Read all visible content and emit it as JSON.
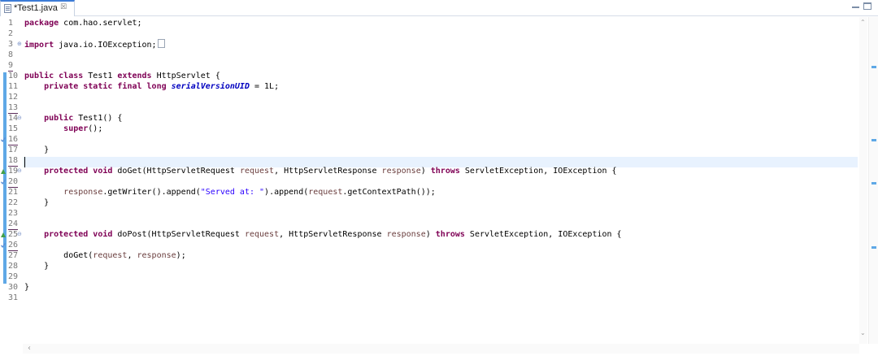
{
  "tab": {
    "title": "*Test1.java",
    "close_glyph": "☒",
    "icon": "java-file-icon"
  },
  "gutter": {
    "line_numbers": [
      "1",
      "2",
      "3",
      "8",
      "9",
      "10",
      "11",
      "12",
      "13",
      "14",
      "15",
      "16",
      "17",
      "18",
      "19",
      "20",
      "21",
      "22",
      "23",
      "24",
      "25",
      "26",
      "27",
      "28",
      "29",
      "30",
      "31"
    ]
  },
  "code": {
    "l1_kw": "package",
    "l1_rest": " com.hao.servlet;",
    "l3_kw": "import",
    "l3_rest": " java.io.IOException;",
    "l10_kw1": "public",
    "l10_kw2": "class",
    "l10_name": " Test1 ",
    "l10_kw3": "extends",
    "l10_rest": " HttpServlet {",
    "l11_indent": "    ",
    "l11_kw": "private static final long",
    "l11_field": "serialVersionUID",
    "l11_rest": " = 1L;",
    "l14_indent": "    ",
    "l14_kw": "public",
    "l14_rest": " Test1() {",
    "l15_indent": "        ",
    "l15_kw": "super",
    "l15_rest": "();",
    "l17": "    }",
    "l19_indent": "    ",
    "l19_kw": "protected void",
    "l19_a": " doGet(HttpServletRequest ",
    "l19_p1": "request",
    "l19_b": ", HttpServletResponse ",
    "l19_p2": "response",
    "l19_c": ") ",
    "l19_kw2": "throws",
    "l19_d": " ServletException, IOException {",
    "l21_indent": "        ",
    "l21_p1": "response",
    "l21_a": ".getWriter().append(",
    "l21_str": "\"Served at: \"",
    "l21_b": ").append(",
    "l21_p2": "request",
    "l21_c": ".getContextPath());",
    "l22": "    }",
    "l25_indent": "    ",
    "l25_kw": "protected void",
    "l25_a": " doPost(HttpServletRequest ",
    "l25_p1": "request",
    "l25_b": ", HttpServletResponse ",
    "l25_p2": "response",
    "l25_c": ") ",
    "l25_kw2": "throws",
    "l25_d": " ServletException, IOException {",
    "l27_indent": "        ",
    "l27_a": "doGet(",
    "l27_p1": "request",
    "l27_b": ", ",
    "l27_p2": "response",
    "l27_c": ");",
    "l28": "    }",
    "l30": "}"
  },
  "colors": {
    "keyword": "#7f0055",
    "string": "#2a00ff",
    "field": "#0000c0",
    "parameter": "#6a3e3e",
    "current_line": "#e8f2fe",
    "change_bar": "#5fa8e6"
  },
  "scroll": {
    "up": "⌃",
    "down": "⌄",
    "left": "‹"
  }
}
